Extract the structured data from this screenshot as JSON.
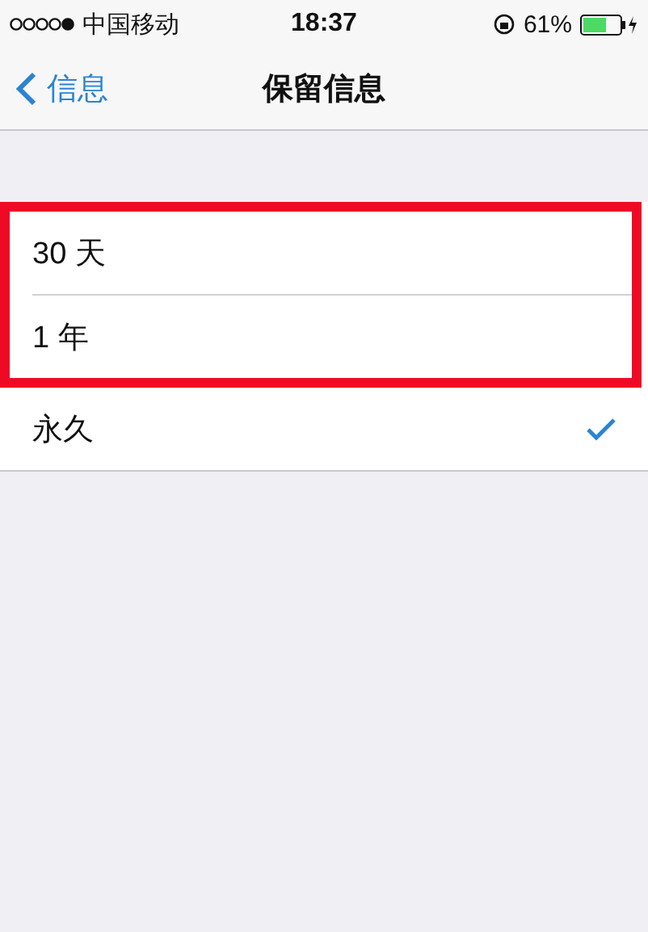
{
  "status_bar": {
    "carrier": "中国移动",
    "time": "18:37",
    "battery": "61%"
  },
  "nav": {
    "back": "信息",
    "title": "保留信息"
  },
  "options": [
    {
      "label": "30 天",
      "selected": false,
      "highlighted": true
    },
    {
      "label": "1 年",
      "selected": false,
      "highlighted": true
    },
    {
      "label": "永久",
      "selected": true,
      "highlighted": false
    }
  ]
}
